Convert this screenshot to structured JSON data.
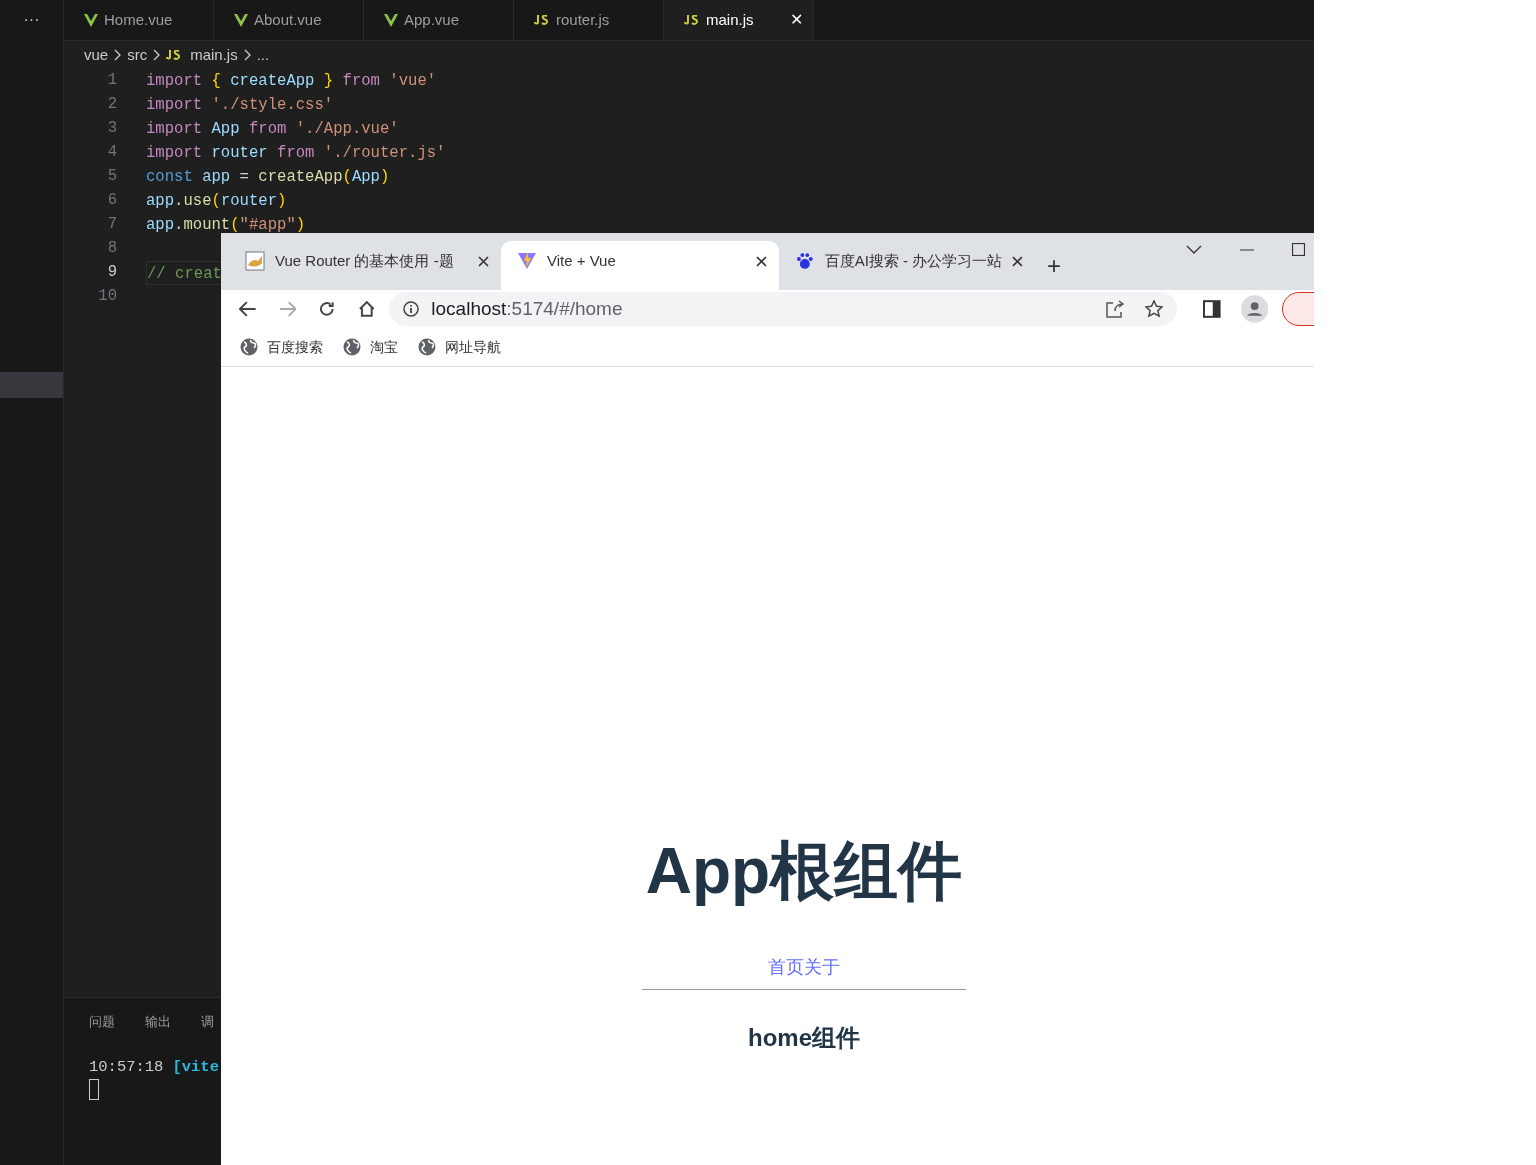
{
  "editor": {
    "more": "···",
    "tabs": [
      {
        "label": "Home.vue",
        "kind": "vue",
        "selected": false
      },
      {
        "label": "About.vue",
        "kind": "vue",
        "selected": false
      },
      {
        "label": "App.vue",
        "kind": "vue",
        "selected": false
      },
      {
        "label": "router.js",
        "kind": "js",
        "selected": false
      },
      {
        "label": "main.js",
        "kind": "js",
        "selected": true,
        "close": "✕"
      }
    ],
    "breadcrumb": [
      "vue",
      "src",
      "main.js",
      "..."
    ],
    "lines": [
      {
        "number": "1",
        "current": false,
        "tokens": [
          {
            "text": "import ",
            "kind": "keyword"
          },
          {
            "text": "{",
            "kind": "bracket"
          },
          {
            "text": " createApp ",
            "kind": "variable"
          },
          {
            "text": "}",
            "kind": "bracket"
          },
          {
            "text": " from ",
            "kind": "keyword"
          },
          {
            "text": "'vue'",
            "kind": "string"
          }
        ]
      },
      {
        "number": "2",
        "current": false,
        "tokens": [
          {
            "text": "import ",
            "kind": "keyword"
          },
          {
            "text": "'./style.css'",
            "kind": "string"
          }
        ]
      },
      {
        "number": "3",
        "current": false,
        "tokens": [
          {
            "text": "import ",
            "kind": "keyword"
          },
          {
            "text": "App ",
            "kind": "variable"
          },
          {
            "text": "from ",
            "kind": "keyword"
          },
          {
            "text": "'./App.vue'",
            "kind": "string"
          }
        ]
      },
      {
        "number": "4",
        "current": false,
        "tokens": [
          {
            "text": "import ",
            "kind": "keyword"
          },
          {
            "text": "router ",
            "kind": "variable"
          },
          {
            "text": "from ",
            "kind": "keyword"
          },
          {
            "text": "'./router.js'",
            "kind": "string"
          }
        ]
      },
      {
        "number": "5",
        "current": false,
        "tokens": [
          {
            "text": "const ",
            "kind": "storage"
          },
          {
            "text": "app",
            "kind": "variable"
          },
          {
            "text": " = "
          },
          {
            "text": "createApp",
            "kind": "function"
          },
          {
            "text": "(",
            "kind": "bracket"
          },
          {
            "text": "App",
            "kind": "variable"
          },
          {
            "text": ")",
            "kind": "bracket"
          }
        ]
      },
      {
        "number": "6",
        "current": false,
        "tokens": [
          {
            "text": "app",
            "kind": "variable"
          },
          {
            "text": "."
          },
          {
            "text": "use",
            "kind": "function"
          },
          {
            "text": "(",
            "kind": "bracket"
          },
          {
            "text": "router",
            "kind": "variable"
          },
          {
            "text": ")",
            "kind": "bracket"
          }
        ]
      },
      {
        "number": "7",
        "current": false,
        "tokens": [
          {
            "text": "app",
            "kind": "variable"
          },
          {
            "text": "."
          },
          {
            "text": "mount",
            "kind": "function"
          },
          {
            "text": "(",
            "kind": "bracket"
          },
          {
            "text": "\"#app\"",
            "kind": "string"
          },
          {
            "text": ")",
            "kind": "bracket"
          }
        ]
      },
      {
        "number": "8",
        "current": false
      },
      {
        "number": "9",
        "current": true,
        "tokens": [
          {
            "text": "// creat",
            "kind": "comment"
          }
        ]
      },
      {
        "number": "10",
        "current": false
      }
    ],
    "panel_tabs": [
      "问题",
      "输出",
      "调"
    ],
    "terminal": {
      "time": "10:57:18",
      "tag": "[vite"
    }
  },
  "browser": {
    "tabs": [
      {
        "title": "Vue Router 的基本使用 -题",
        "kind": "cat",
        "selected": false
      },
      {
        "title": "Vite + Vue",
        "kind": "vite",
        "selected": true
      },
      {
        "title": "百度AI搜索 - 办公学习一站",
        "kind": "paw",
        "selected": false
      }
    ],
    "new_tab": "+",
    "url_host": "localhost",
    "url_rest": ":5174/#/home",
    "bookmarks": [
      "百度搜索",
      "淘宝",
      "网址导航"
    ],
    "page": {
      "heading": "App根组件",
      "links": [
        "首页",
        "关于"
      ],
      "subheading": "home组件"
    }
  }
}
